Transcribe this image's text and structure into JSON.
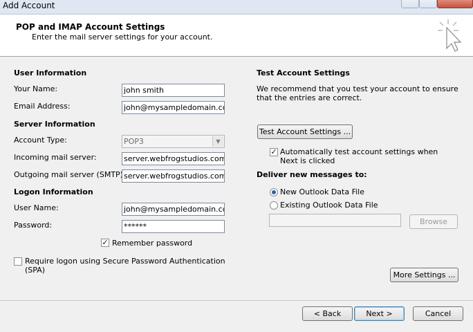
{
  "window": {
    "title": "Add Account"
  },
  "header": {
    "title": "POP and IMAP Account Settings",
    "subtitle": "Enter the mail server settings for your account."
  },
  "user_info": {
    "section": "User Information",
    "name_label": "Your Name:",
    "name_value": "john smith",
    "email_label": "Email Address:",
    "email_value": "john@mysampledomain.com"
  },
  "server_info": {
    "section": "Server Information",
    "account_type_label": "Account Type:",
    "account_type_value": "POP3",
    "incoming_label": "Incoming mail server:",
    "incoming_value": "server.webfrogstudios.com.au",
    "outgoing_label": "Outgoing mail server (SMTP):",
    "outgoing_value": "server.webfrogstudios.com.au"
  },
  "logon_info": {
    "section": "Logon Information",
    "username_label": "User Name:",
    "username_value": "john@mysampledomain.com",
    "password_label": "Password:",
    "password_value": "******",
    "remember_label": "Remember password",
    "remember_checked": true,
    "spa_label": "Require logon using Secure Password Authentication (SPA)",
    "spa_checked": false
  },
  "test": {
    "section": "Test Account Settings",
    "description": "We recommend that you test your account to ensure that the entries are correct.",
    "button": "Test Account Settings ...",
    "auto_label": "Automatically test account settings when Next is clicked",
    "auto_checked": true
  },
  "deliver": {
    "section": "Deliver new messages to:",
    "new_file_label": "New Outlook Data File",
    "existing_file_label": "Existing Outlook Data File",
    "selected": "new",
    "browse": "Browse"
  },
  "buttons": {
    "more_settings": "More Settings ...",
    "back": "< Back",
    "next": "Next >",
    "cancel": "Cancel"
  },
  "colors": {
    "accent": "#2a5fb0",
    "header_bg": "#ffffff",
    "dialog_bg": "#f0f0f0"
  }
}
